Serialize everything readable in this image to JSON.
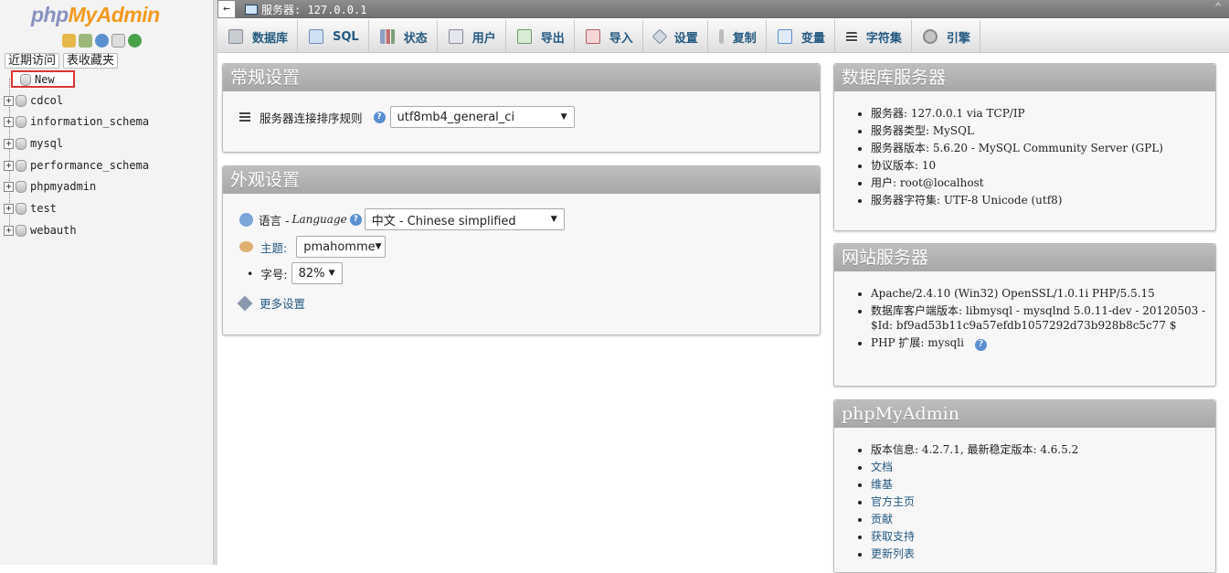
{
  "nav": {
    "logo_php": "php",
    "logo_my": "My",
    "logo_admin": "Admin",
    "icons": [
      "home-icon",
      "exit-icon",
      "help-icon",
      "docs-icon",
      "reload-icon"
    ],
    "tabs": [
      "近期访问",
      "表收藏夹"
    ],
    "new_label": "New",
    "databases": [
      "cdcol",
      "information_schema",
      "mysql",
      "performance_schema",
      "phpmyadmin",
      "test",
      "webauth"
    ]
  },
  "topbar": {
    "back": "←",
    "server": "服务器: 127.0.0.1",
    "collapse": "⌃"
  },
  "menu": {
    "tabs": [
      {
        "label": "数据库",
        "icon": "database-icon",
        "color": "#9aa"
      },
      {
        "label": "SQL",
        "icon": "sql-icon",
        "color": "#7ba6d8"
      },
      {
        "label": "状态",
        "icon": "status-icon",
        "color": "#a9b8c9"
      },
      {
        "label": "用户",
        "icon": "users-icon",
        "color": "#8aa"
      },
      {
        "label": "导出",
        "icon": "export-icon",
        "color": "#7bb07b"
      },
      {
        "label": "导入",
        "icon": "import-icon",
        "color": "#d26d6d"
      },
      {
        "label": "设置",
        "icon": "wrench-icon",
        "color": "#8a98ad"
      },
      {
        "label": "复制",
        "icon": "replicate-icon",
        "color": "#9a9a9a"
      },
      {
        "label": "变量",
        "icon": "variables-icon",
        "color": "#5c8ed0"
      },
      {
        "label": "字符集",
        "icon": "charset-icon",
        "color": "#555"
      },
      {
        "label": "引擎",
        "icon": "engine-icon",
        "color": "#8f8f8f"
      }
    ]
  },
  "general": {
    "title": "常规设置",
    "collation_label": "服务器连接排序规则",
    "collation_value": "utf8mb4_general_ci"
  },
  "appearance": {
    "title": "外观设置",
    "language_label": "语言 - ",
    "language_italic": "Language",
    "language_value": "中文 - Chinese simplified",
    "theme_label": "主题:",
    "theme_value": "pmahomme",
    "fontsize_label": "字号:",
    "fontsize_value": "82%",
    "more_label": "更多设置"
  },
  "db_server": {
    "title": "数据库服务器",
    "items": [
      "服务器: 127.0.0.1 via TCP/IP",
      "服务器类型: MySQL",
      "服务器版本: 5.6.20 - MySQL Community Server (GPL)",
      "协议版本: 10",
      "用户: root@localhost",
      "服务器字符集: UTF-8 Unicode (utf8)"
    ]
  },
  "web_server": {
    "title": "网站服务器",
    "items": [
      "Apache/2.4.10 (Win32) OpenSSL/1.0.1i PHP/5.5.15",
      "数据库客户端版本: libmysql - mysqlnd 5.0.11-dev - 20120503 - $Id: bf9ad53b11c9a57efdb1057292d73b928b8c5c77 $",
      "PHP 扩展: mysqli"
    ]
  },
  "pma": {
    "title": "phpMyAdmin",
    "version": "版本信息: 4.2.7.1, 最新稳定版本: 4.6.5.2",
    "links": [
      "文档",
      "维基",
      "官方主页",
      "贡献",
      "获取支持",
      "更新列表"
    ]
  }
}
